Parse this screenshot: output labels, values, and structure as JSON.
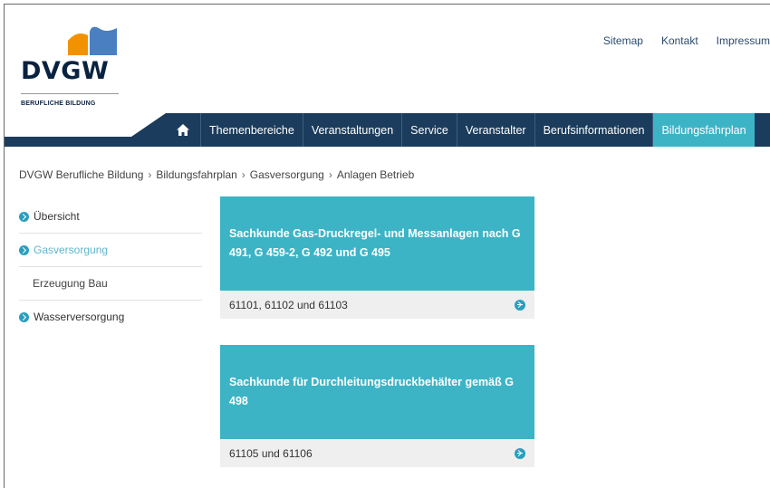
{
  "logo": {
    "name": "DVGW",
    "subtitle": "BERUFLICHE BILDUNG"
  },
  "top_links": [
    "Sitemap",
    "Kontakt",
    "Impressum"
  ],
  "nav": {
    "home_icon": "home-icon",
    "items": [
      "Themenbereiche",
      "Veranstaltungen",
      "Service",
      "Veranstalter",
      "Berufsinformationen",
      "Bildungsfahrplan"
    ],
    "active_index": 5
  },
  "breadcrumb": [
    "DVGW Berufliche Bildung",
    "Bildungsfahrplan",
    "Gasversorgung",
    "Anlagen Betrieb"
  ],
  "sidebar": {
    "items": [
      {
        "label": "Übersicht"
      },
      {
        "label": "Gasversorgung"
      },
      {
        "label": "Erzeugung Bau"
      },
      {
        "label": "Wasserversorgung"
      }
    ]
  },
  "cards": [
    {
      "title": "Sachkunde Gas-Druckregel- und Messanlagen nach G 491, G 459-2, G 492 und G 495",
      "codes": "61101, 61102 und 61103"
    },
    {
      "title": "Sachkunde für Durchleitungsdruckbehälter gemäß G 498",
      "codes": "61105 und 61106"
    }
  ],
  "colors": {
    "navy": "#1b3c5c",
    "teal": "#3cb4c6",
    "logo_orange": "#f39200",
    "logo_blue": "#4a7fc1"
  }
}
